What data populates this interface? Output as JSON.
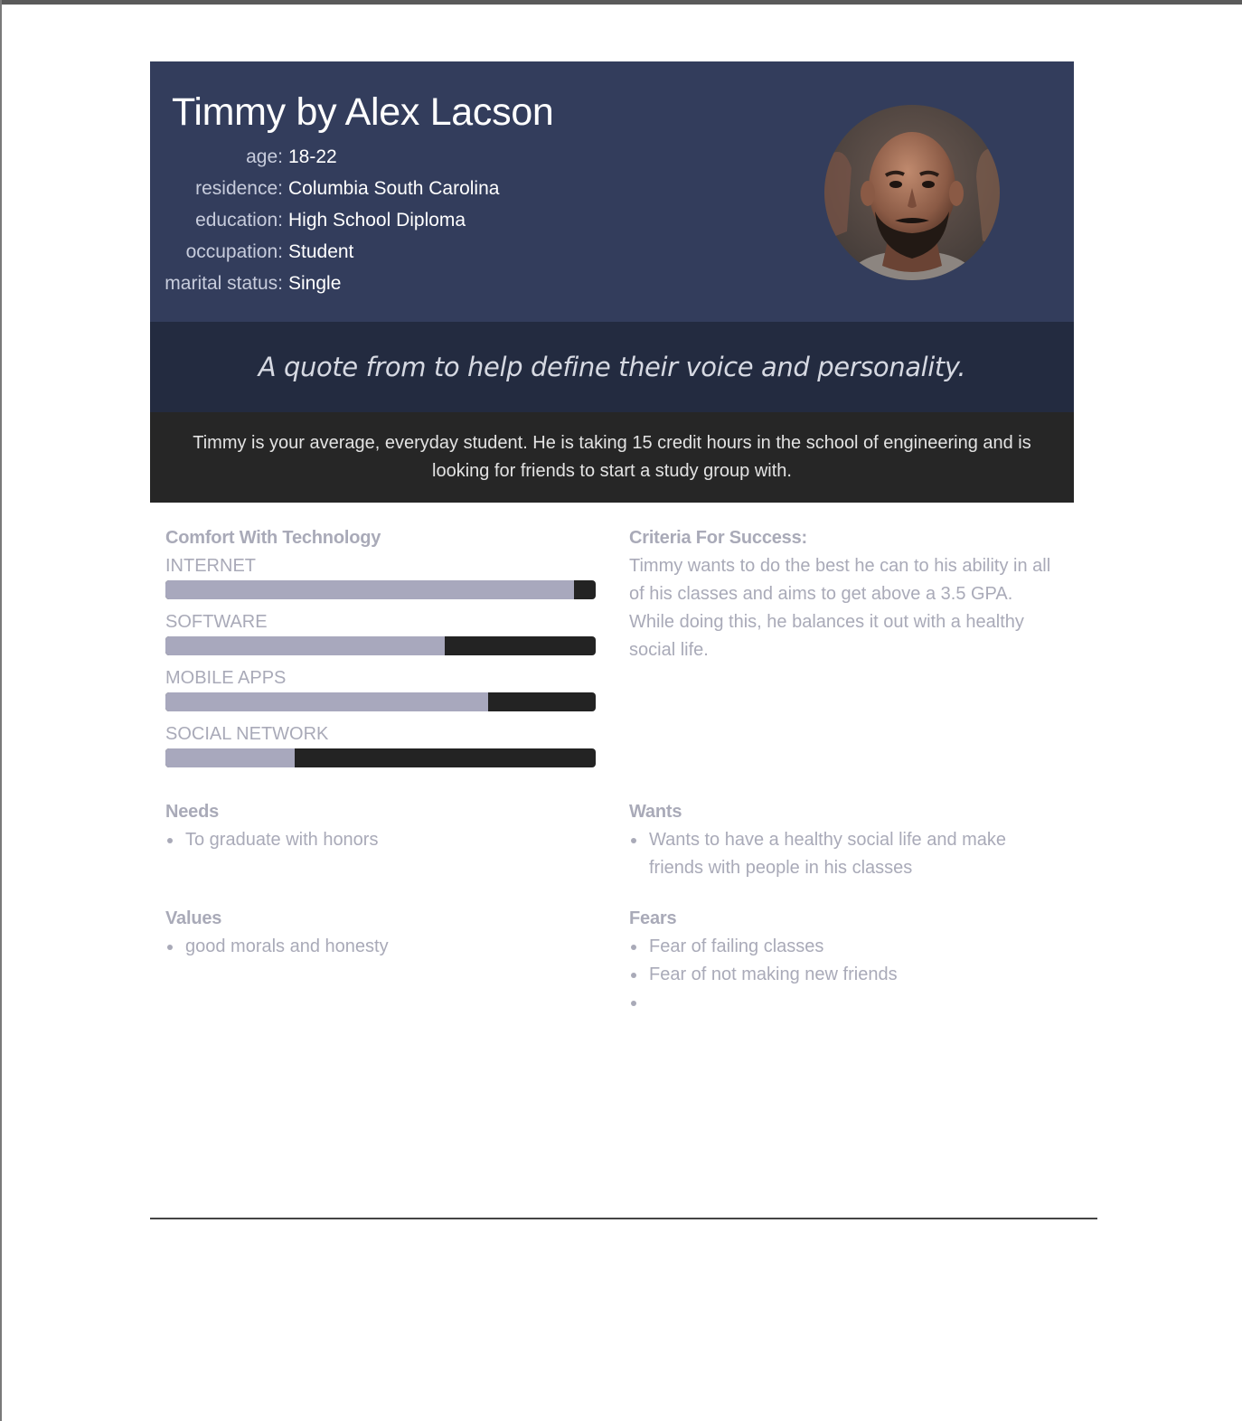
{
  "persona": {
    "title": "Timmy by Alex Lacson",
    "attributes": [
      {
        "key": "age:",
        "value": "18-22"
      },
      {
        "key": "residence:",
        "value": "Columbia South Carolina"
      },
      {
        "key": "education:",
        "value": "High School Diploma"
      },
      {
        "key": "occupation:",
        "value": "Student"
      },
      {
        "key": "marital status:",
        "value": "Single"
      }
    ],
    "quote": "A quote from to help define their voice and personality.",
    "bio": "Timmy is your average, everyday student. He is taking 15 credit hours in the school of engineering and is looking for friends to start a study group with."
  },
  "technology": {
    "label": "Comfort With Technology",
    "items": [
      {
        "label": "INTERNET",
        "level": 0.95
      },
      {
        "label": "SOFTWARE",
        "level": 0.65
      },
      {
        "label": "MOBILE APPS",
        "level": 0.75
      },
      {
        "label": "SOCIAL NETWORK",
        "level": 0.3
      }
    ]
  },
  "criteria": {
    "label": "Criteria For Success:",
    "text": "Timmy wants to do the best he can to his ability in all of his classes and aims to get above a 3.5 GPA. While doing this, he balances it out with a healthy social life."
  },
  "needs": {
    "label": "Needs",
    "items": [
      "To graduate with honors"
    ]
  },
  "wants": {
    "label": "Wants",
    "items": [
      "Wants to have a healthy social life and make friends with people in his classes"
    ]
  },
  "values": {
    "label": "Values",
    "items": [
      "good morals and honesty"
    ]
  },
  "fears": {
    "label": "Fears",
    "items": [
      "Fear of failing classes",
      "Fear of not making new friends",
      ""
    ]
  },
  "colors": {
    "header_bg": "#333d5c",
    "quote_bg": "#232b40",
    "bio_bg": "#262626",
    "bar_fill": "#a8a8bd",
    "bar_track": "#232323",
    "muted_text": "#a9aab8"
  }
}
